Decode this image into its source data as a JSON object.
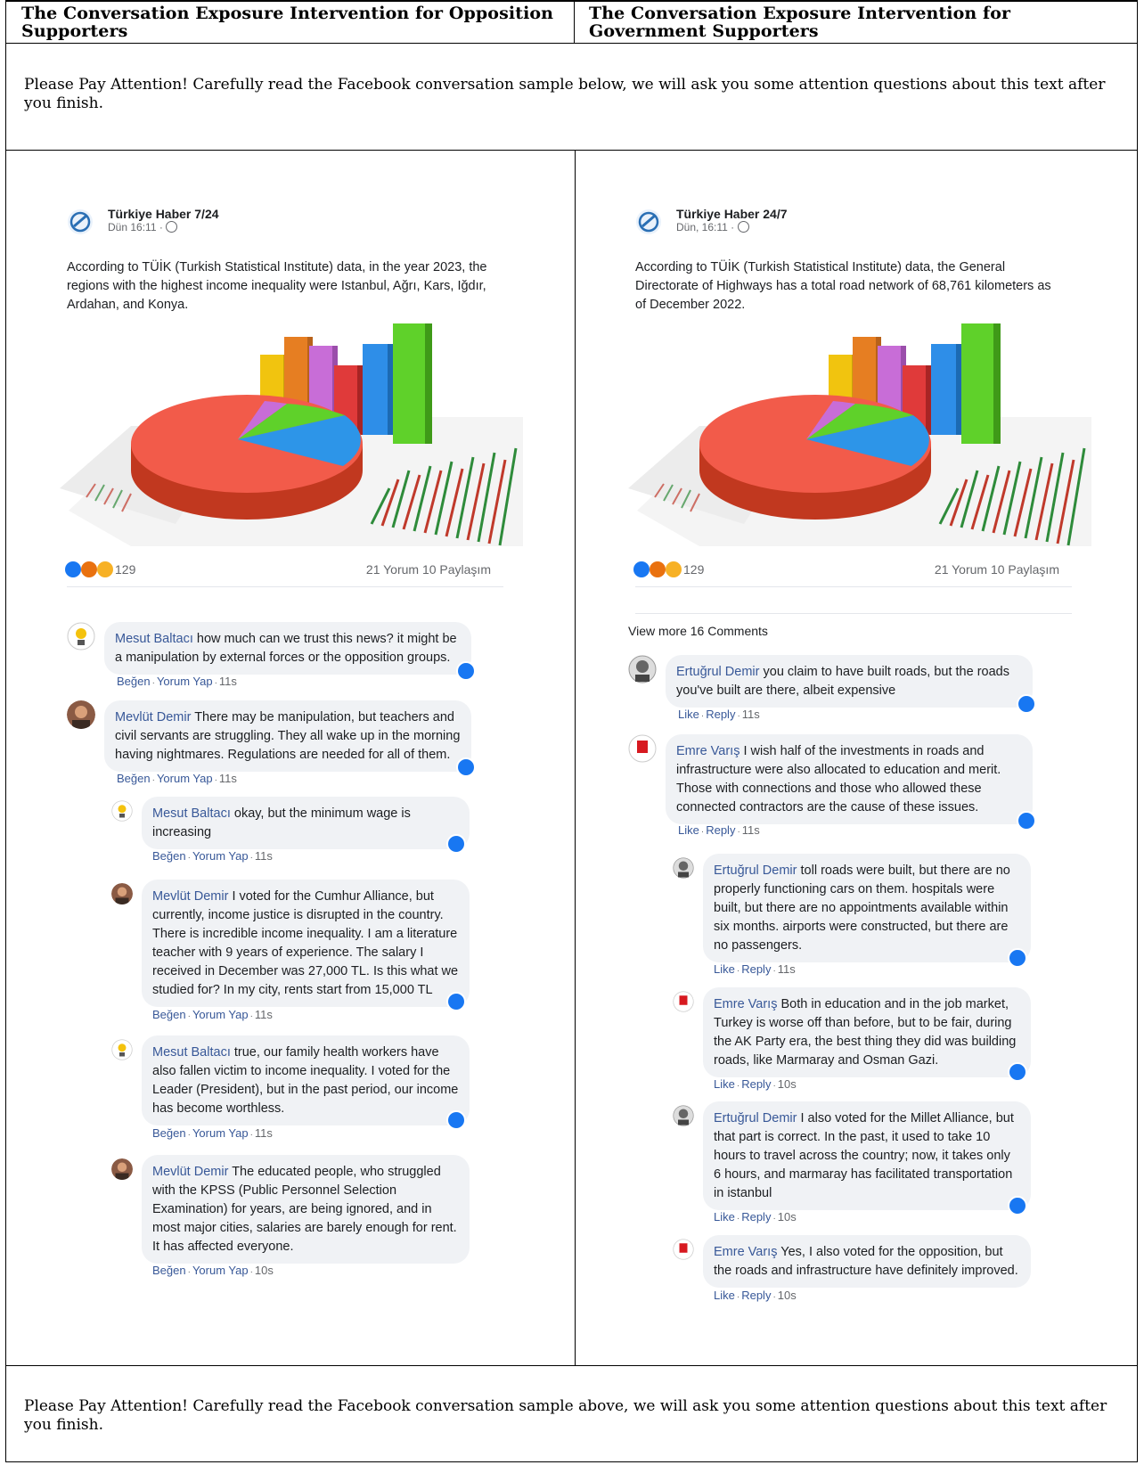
{
  "header": {
    "left": "The Conversation Exposure Intervention for Opposition Supporters",
    "right": "The Conversation Exposure Intervention for Government Supporters"
  },
  "notice_top": "Please Pay Attention! Carefully read the Facebook conversation sample below, we will ask you some attention questions about this text after you finish.",
  "notice_bottom": "Please Pay Attention! Carefully read the Facebook conversation sample above, we will ask you some attention questions about this text after you finish.",
  "left_post": {
    "page_name": "Türkiye Haber 7/24",
    "time": "Dün 16:11 ·",
    "text": "According to TÜİK (Turkish Statistical Institute) data, in the year 2023, the regions with the highest income inequality were Istanbul, Ağrı, Kars, Iğdır, Ardahan, and Konya.",
    "reaction_count": "129",
    "comments_shares": "21 Yorum 10 Paylaşım",
    "comments": [
      {
        "author": "Mesut Baltacı",
        "text": "how much can we trust this news? it might be a manipulation by external forces or the opposition groups.",
        "like": "Beğen",
        "reply": "Yorum Yap",
        "time": "11s"
      },
      {
        "author": "Mevlüt Demir",
        "text": "There may be manipulation, but teachers and civil servants are struggling. They all wake up in the morning having nightmares. Regulations are needed for all of them.",
        "like": "Beğen",
        "reply": "Yorum Yap",
        "time": "11s"
      },
      {
        "author": "Mesut Baltacı",
        "text": "okay, but the minimum wage is increasing",
        "like": "Beğen",
        "reply": "Yorum Yap",
        "time": "11s"
      },
      {
        "author": "Mevlüt Demir",
        "text": "I voted for the Cumhur Alliance, but currently, income justice is disrupted in the country. There is incredible income inequality. I am a literature teacher with 9 years of experience. The salary I received in December was 27,000 TL. Is this what we studied for? In my city, rents start from 15,000 TL",
        "like": "Beğen",
        "reply": "Yorum Yap",
        "time": "11s"
      },
      {
        "author": "Mesut Baltacı",
        "text": "true, our family health workers have also fallen victim to income inequality. I voted for the Leader (President), but in the past period, our income has become worthless.",
        "like": "Beğen",
        "reply": "Yorum Yap",
        "time": "11s"
      },
      {
        "author": "Mevlüt Demir",
        "text": "The educated people, who struggled with the KPSS (Public Personnel Selection Examination) for years, are being ignored, and in most major cities, salaries are barely enough for rent. It has affected everyone.",
        "like": "Beğen",
        "reply": "Yorum Yap",
        "time": "10s"
      }
    ]
  },
  "right_post": {
    "page_name": "Türkiye Haber 24/7",
    "time": "Dün, 16:11 ·",
    "text": "According to TÜİK (Turkish Statistical Institute) data, the General Directorate of Highways has a total road network of 68,761 kilometers as of December 2022.",
    "reaction_count": "129",
    "comments_shares": "21 Yorum 10 Paylaşım",
    "view_more": "View more 16 Comments",
    "comments": [
      {
        "author": "Ertuğrul Demir",
        "text": "you claim to have built roads, but the roads you've built are there, albeit expensive",
        "like": "Like",
        "reply": "Reply",
        "time": "11s"
      },
      {
        "author": "Emre Varış",
        "text": "I wish half of the investments in roads and infrastructure were also allocated to education and merit. Those with connections and those who allowed these connected contractors are the cause of these issues.",
        "like": "Like",
        "reply": "Reply",
        "time": "11s"
      },
      {
        "author": "Ertuğrul Demir",
        "text": "toll roads were built, but there are no properly functioning cars on them. hospitals were built, but there are no appointments available within six months. airports were constructed, but there are no passengers.",
        "like": "Like",
        "reply": "Reply",
        "time": "11s"
      },
      {
        "author": "Emre Varış",
        "text": "Both in education and in the job market, Turkey is worse off than before, but to be fair, during the AK Party era, the best thing they did was building roads, like Marmaray and Osman Gazi.",
        "like": "Like",
        "reply": "Reply",
        "time": "10s"
      },
      {
        "author": "Ertuğrul Demir",
        "text": "I also voted for the Millet Alliance, but that part is correct. In the past, it used to take 10 hours to travel across the country; now, it takes only 6 hours, and marmaray has facilitated transportation in istanbul",
        "like": "Like",
        "reply": "Reply",
        "time": "10s"
      },
      {
        "author": "Emre Varış",
        "text": "Yes, I also voted for the opposition, but the roads and infrastructure have definitely improved.",
        "like": "Like",
        "reply": "Reply",
        "time": "10s"
      }
    ]
  },
  "colors": {
    "fb_blue": "#1877f2",
    "author_blue": "#385898",
    "bubble_gray": "#f0f2f5",
    "meta_gray": "#65676b"
  },
  "icons": {
    "globe": "globe-icon",
    "like": "like-icon",
    "angry": "angry-reaction-icon",
    "wow": "wow-reaction-icon"
  }
}
